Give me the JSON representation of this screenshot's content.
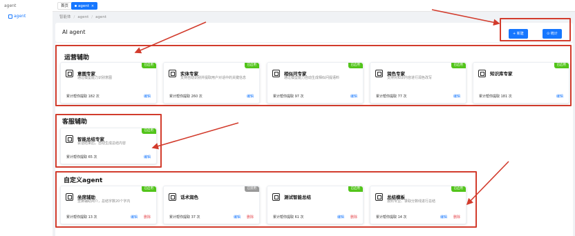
{
  "sidebar": {
    "title": "agent",
    "item": "agent"
  },
  "tabs": [
    {
      "label": "首页"
    },
    {
      "label": "agent"
    }
  ],
  "breadcrumb": [
    "智能体",
    "agent",
    "agent"
  ],
  "header": {
    "title": "AI agent",
    "new_label": "+ 新建",
    "stats_label": "⊙ 统计"
  },
  "sections": [
    {
      "title": "运营辅助",
      "cards": [
        {
          "name": "意图专家",
          "desc": "通过模型能力识别意图",
          "count": "累计帮你提取 182 次",
          "badge": "已启用",
          "edit": "编辑"
        },
        {
          "name": "实体专家",
          "desc": "支持自动识别并提取用户对话中的关键信息",
          "count": "累计帮你提取 260 次",
          "badge": "已启用",
          "edit": "编辑"
        },
        {
          "name": "相似问专家",
          "desc": "通过模型能力自动生成相似问提语料",
          "count": "累计帮你提取 97 次",
          "badge": "已启用",
          "edit": "编辑"
        },
        {
          "name": "润色专家",
          "desc": "支持对知识内容进行润色改写",
          "count": "累计帮你提取 77 次",
          "badge": "已启用",
          "edit": "编辑"
        },
        {
          "name": "知识库专家",
          "desc": "",
          "count": "累计帮你提取 181 次",
          "badge": "已启用",
          "edit": "编辑"
        }
      ]
    },
    {
      "title": "客服辅助",
      "cards": [
        {
          "name": "智能总结专家",
          "desc": "会话结束后，自动生成总结内容",
          "count": "累计帮你提取 65 次",
          "badge": "已启用",
          "edit": "编辑"
        }
      ]
    },
    {
      "title": "自定义agent",
      "cards": [
        {
          "name": "坐席辅助",
          "desc": "坐席辅助简介，总结字数20个字内",
          "count": "累计帮你提取 13 次",
          "badge": "已启用",
          "edit": "编辑",
          "del": "删除"
        },
        {
          "name": "话术润色",
          "desc": "",
          "count": "累计帮你提取 37 次",
          "badge": "已禁用",
          "edit": "编辑",
          "del": "删除"
        },
        {
          "name": "测试智能总结",
          "desc": "",
          "count": "累计帮你提取 61 次",
          "badge": "已启用",
          "edit": "编辑",
          "del": "删除"
        },
        {
          "name": "总结模板",
          "desc": "按照专业、录取分数线进行总结",
          "count": "累计帮你提取 14 次",
          "badge": "已启用",
          "edit": "编辑",
          "del": "删除"
        }
      ]
    }
  ],
  "colors": {
    "primary": "#1677ff",
    "enabled": "#52c41a",
    "disabled": "#999999",
    "annotation": "#d23b2c"
  }
}
